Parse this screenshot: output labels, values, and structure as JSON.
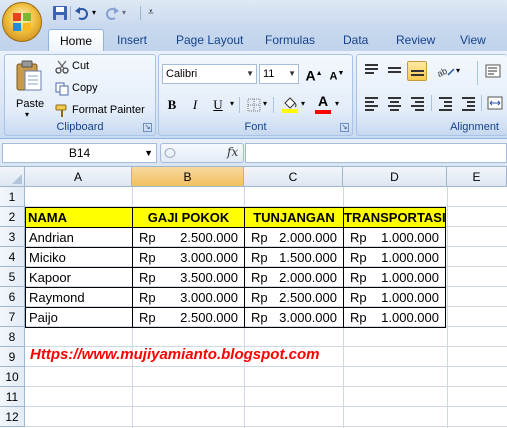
{
  "quick_access": {
    "icons": [
      "save-icon",
      "undo-icon",
      "redo-icon",
      "customize-icon"
    ]
  },
  "tabs": [
    "Home",
    "Insert",
    "Page Layout",
    "Formulas",
    "Data",
    "Review",
    "View"
  ],
  "ribbon": {
    "clipboard": {
      "label": "Clipboard",
      "paste": "Paste",
      "cut": "Cut",
      "copy": "Copy",
      "format_painter": "Format Painter"
    },
    "font": {
      "label": "Font",
      "font_name": "Calibri",
      "font_size": "11",
      "grow": "A",
      "shrink": "A",
      "bold": "B",
      "italic": "I",
      "underline": "U",
      "font_color_letter": "A",
      "font_color": "#ff0000",
      "fill_color": "#ffff00"
    },
    "alignment": {
      "label": "Alignment"
    }
  },
  "formula_bar": {
    "name_box": "B14",
    "fx": "fx",
    "value": ""
  },
  "sheet": {
    "columns": [
      "A",
      "B",
      "C",
      "D",
      "E"
    ],
    "rows": [
      "1",
      "2",
      "3",
      "4",
      "5",
      "6",
      "7",
      "8",
      "9",
      "10",
      "11",
      "12"
    ],
    "headers": [
      "NAMA",
      "GAJI POKOK",
      "TUNJANGAN",
      "TRANSPORTASI"
    ],
    "currency": "Rp",
    "data": [
      {
        "name": "Andrian",
        "gaji": "2.500.000",
        "tunjangan": "2.000.000",
        "transport": "1.000.000"
      },
      {
        "name": "Miciko",
        "gaji": "3.000.000",
        "tunjangan": "1.500.000",
        "transport": "1.000.000"
      },
      {
        "name": "Kapoor",
        "gaji": "3.500.000",
        "tunjangan": "2.000.000",
        "transport": "1.000.000"
      },
      {
        "name": "Raymond",
        "gaji": "3.000.000",
        "tunjangan": "2.500.000",
        "transport": "1.000.000"
      },
      {
        "name": "Paijo",
        "gaji": "2.500.000",
        "tunjangan": "3.000.000",
        "transport": "1.000.000"
      }
    ],
    "url": "Https://www.mujiyamianto.blogspot.com",
    "header_fill": "#ffff00",
    "url_color": "#ff0000"
  }
}
